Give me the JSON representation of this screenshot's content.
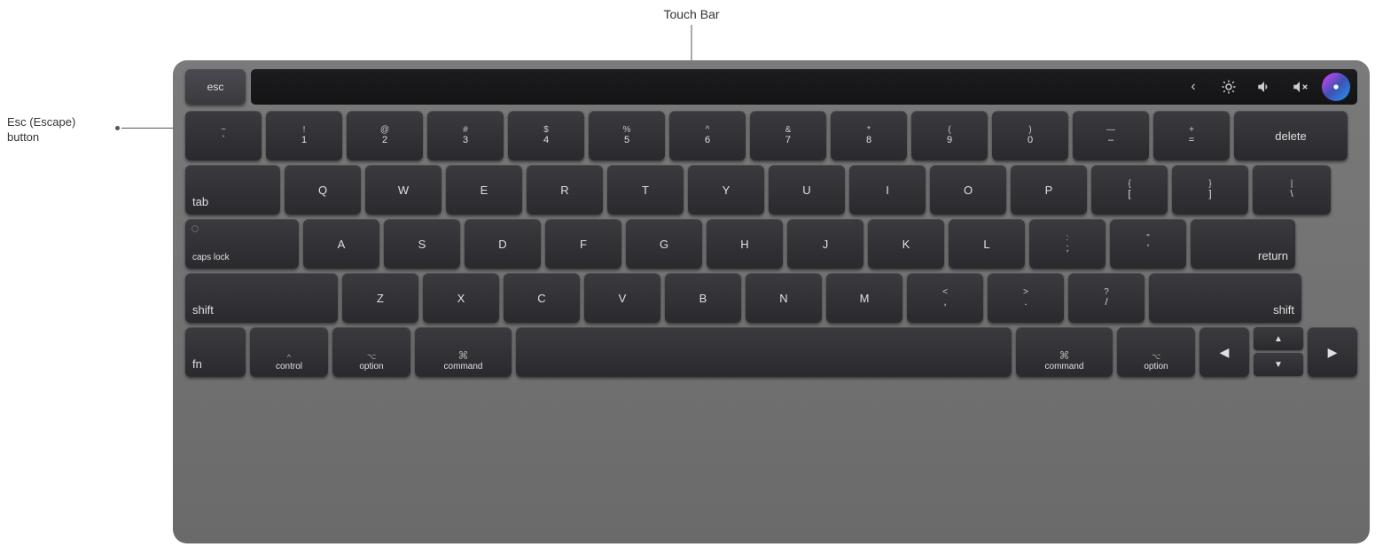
{
  "labels": {
    "touchbar": "Touch Bar",
    "esc_label_line1": "Esc (Escape)",
    "esc_label_line2": "button"
  },
  "touchbar": {
    "esc": "esc",
    "icons": [
      "‹",
      "☀",
      "◀",
      "🔇",
      "siri"
    ]
  },
  "rows": {
    "row1": [
      {
        "top": "~",
        "bot": "`"
      },
      {
        "top": "!",
        "bot": "1"
      },
      {
        "top": "@",
        "bot": "2"
      },
      {
        "top": "#",
        "bot": "3"
      },
      {
        "top": "$",
        "bot": "4"
      },
      {
        "top": "%",
        "bot": "5"
      },
      {
        "top": "^",
        "bot": "6"
      },
      {
        "top": "&",
        "bot": "7"
      },
      {
        "top": "*",
        "bot": "8"
      },
      {
        "top": "(",
        "bot": "9"
      },
      {
        "top": ")",
        "bot": "0"
      },
      {
        "top": "—",
        "bot": "–",
        "alt": "_",
        "-": "-"
      },
      {
        "top": "+",
        "bot": "="
      }
    ],
    "row1_delete": "delete",
    "row2": [
      "Q",
      "W",
      "E",
      "R",
      "T",
      "Y",
      "U",
      "I",
      "O",
      "P"
    ],
    "row2_tab": "tab",
    "row2_bracket_open": [
      "{",
      "["
    ],
    "row2_bracket_close": [
      "}",
      "]"
    ],
    "row2_backslash": [
      "|",
      "\\"
    ],
    "row3": [
      "A",
      "S",
      "D",
      "F",
      "G",
      "H",
      "J",
      "K",
      "L"
    ],
    "row3_caps": "caps lock",
    "row3_semi": [
      ":",
      ";"
    ],
    "row3_quote": [
      "\"",
      "'"
    ],
    "row3_return": "return",
    "row4": [
      "Z",
      "X",
      "C",
      "V",
      "B",
      "N",
      "M"
    ],
    "row4_shift": "shift",
    "row4_lt": [
      "<",
      ","
    ],
    "row4_gt": [
      ">",
      "."
    ],
    "row4_slash": [
      "?",
      "/"
    ],
    "row5_fn": "fn",
    "row5_ctrl": "control",
    "row5_opt_l": "option",
    "row5_cmd_l": "command",
    "row5_cmd_r": "command",
    "row5_opt_r": "option",
    "arrows": [
      "▲",
      "◀",
      "▼",
      "▶"
    ]
  }
}
